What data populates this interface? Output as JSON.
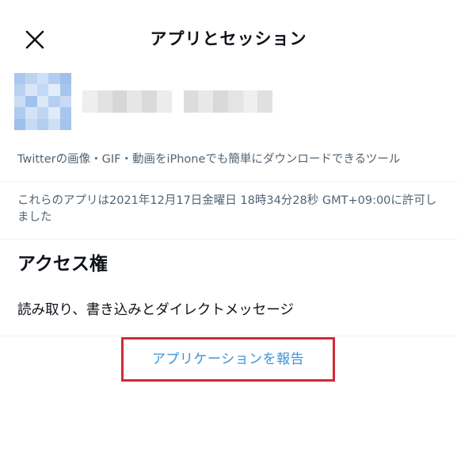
{
  "header": {
    "title": "アプリとセッション",
    "close_icon": "close-icon"
  },
  "app": {
    "avatar_icon": "pixelated-app-avatar",
    "description": "Twitterの画像・GIF・動画をiPhoneでも簡単にダウンロードできるツール"
  },
  "authorization": {
    "text": "これらのアプリは2021年12月17日金曜日 18時34分28秒 GMT+09:00に許可しました"
  },
  "access": {
    "heading": "アクセス権",
    "value": "読み取り、書き込みとダイレクトメッセージ"
  },
  "report": {
    "label": "アプリケーションを報告",
    "highlight_color": "#cf2b35",
    "link_color": "#3b94d9"
  }
}
